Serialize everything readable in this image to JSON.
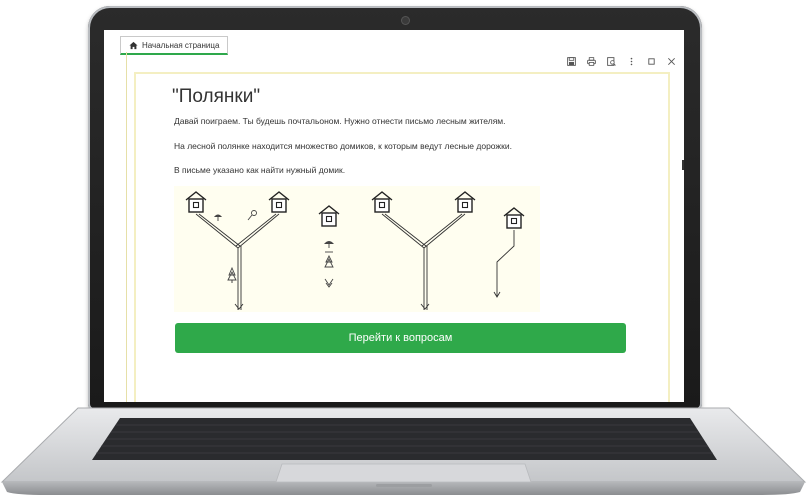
{
  "tab": {
    "label": "Начальная страница",
    "icon": "home-icon"
  },
  "window_controls": [
    "save-icon",
    "print-icon",
    "preview-icon",
    "more-icon",
    "maximize-icon",
    "close-icon"
  ],
  "content": {
    "title": "\"Полянки\"",
    "paragraphs": [
      "Давай поиграем. Ты будешь почтальоном. Нужно отнести письмо лесным жителям.",
      "На лесной полянке находится множество домиков, к которым ведут лесные дорожки.",
      "В письме указано как найти нужный домик."
    ]
  },
  "button": {
    "label": "Перейти к вопросам"
  },
  "colors": {
    "accent": "#2fa94a",
    "panel_border": "#f4efc2",
    "illustration_bg": "#fffef0"
  }
}
